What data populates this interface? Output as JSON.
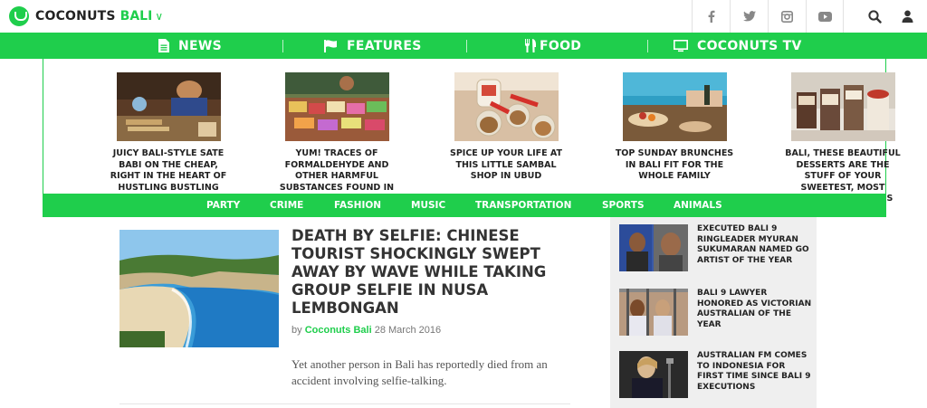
{
  "header": {
    "logo_text": "COCONUTS",
    "logo_region": "BALI",
    "region_chevron": "∨",
    "social": [
      "facebook-icon",
      "twitter-icon",
      "instagram-icon",
      "youtube-icon"
    ],
    "tools": [
      "search-icon",
      "user-icon"
    ]
  },
  "nav": {
    "items": [
      {
        "label": "NEWS",
        "icon": "document-icon"
      },
      {
        "label": "FEATURES",
        "icon": "flag-icon"
      },
      {
        "label": "FOOD",
        "icon": "cutlery-icon"
      },
      {
        "label": "COCONUTS TV",
        "icon": "monitor-icon"
      }
    ]
  },
  "dropdown": {
    "stories": [
      {
        "title": "JUICY BALI-STYLE SATE BABI ON THE CHEAP, RIGHT IN THE HEART OF HUSTLING BUSTLING LEGIAN"
      },
      {
        "title": "YUM! TRACES OF FORMALDEHYDE AND OTHER HARMFUL SUBSTANCES FOUND IN"
      },
      {
        "title": "SPICE UP YOUR LIFE AT THIS LITTLE SAMBAL SHOP IN UBUD"
      },
      {
        "title": "TOP SUNDAY BRUNCHES IN BALI FIT FOR THE WHOLE FAMILY"
      },
      {
        "title": "BALI, THESE BEAUTIFUL DESSERTS ARE THE STUFF OF YOUR SWEETEST, MOST WHIMSICAL DREAMS"
      }
    ]
  },
  "categories": [
    "PARTY",
    "CRIME",
    "FASHION",
    "MUSIC",
    "TRANSPORTATION",
    "SPORTS",
    "ANIMALS"
  ],
  "article": {
    "title": "DEATH BY SELFIE: CHINESE TOURIST SHOCKINGLY SWEPT AWAY BY WAVE WHILE TAKING GROUP SELFIE IN NUSA LEMBONGAN",
    "by": "by",
    "author": "Coconuts Bali",
    "date": "28 March 2016",
    "excerpt": "Yet another person in Bali has reportedly died from an accident involving selfie-talking."
  },
  "sidebar": {
    "items": [
      {
        "title": "EXECUTED BALI 9 RINGLEADER MYURAN SUKUMARAN NAMED GO ARTIST OF THE YEAR"
      },
      {
        "title": "BALI 9 LAWYER HONORED AS VICTORIAN AUSTRALIAN OF THE YEAR"
      },
      {
        "title": "AUSTRALIAN FM COMES TO INDONESIA FOR FIRST TIME SINCE BALI 9 EXECUTIONS"
      }
    ]
  },
  "colors": {
    "brand": "#1fce4c",
    "text_dark": "#333333",
    "sidebar_bg": "#efefef"
  }
}
